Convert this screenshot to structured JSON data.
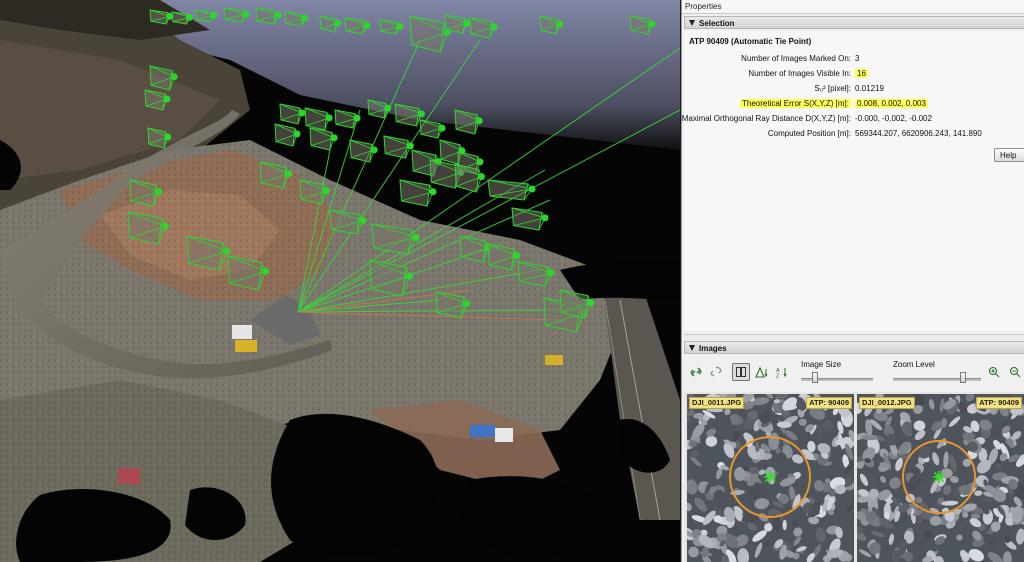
{
  "properties": {
    "panel_title": "Properties",
    "selection_header": "Selection",
    "atp_title": "ATP 90409 (Automatic Tie Point)",
    "rows": [
      {
        "label": "Number of Images Marked On:",
        "value": "3",
        "highlight": false
      },
      {
        "label": "Number of Images Visible In:",
        "value": "16",
        "highlight": true
      },
      {
        "label": "S₀² [pixel]:",
        "value": "0.01219",
        "highlight": false
      },
      {
        "label": "Theoretical Error S(X,Y,Z) [m]:",
        "value": "0.008, 0.002, 0.003",
        "highlight": true
      },
      {
        "label": "Maximal Orthogonal Ray Distance D(X,Y,Z) [m]:",
        "value": "-0.000, -0.002, -0.002",
        "highlight": false
      },
      {
        "label": "Computed Position [m]:",
        "value": "569344.207, 6620906.243, 141.890",
        "highlight": false
      }
    ],
    "help_button": "Help"
  },
  "images_panel": {
    "header": "Images",
    "toolbar": {
      "icons": [
        "link-icon",
        "unlink-icon",
        "vertical-layout-icon",
        "sort-triangle-icon",
        "sort-az-icon"
      ],
      "image_size_label": "Image Size",
      "image_size_value": 0.17,
      "zoom_level_label": "Zoom Level",
      "zoom_level_value": 0.82,
      "zoom_in_icon": "zoom-in-icon",
      "zoom_out_icon": "zoom-out-icon"
    },
    "thumbnails": [
      {
        "filename": "DJI_0011.JPG",
        "atp": "ATP: 90409"
      },
      {
        "filename": "DJI_0012.JPG",
        "atp": "ATP: 90409"
      }
    ],
    "marker_color": "#e8952a",
    "tie_point_color": "#3ddc2a"
  },
  "viewport": {
    "camera_color": "#2ed52e",
    "sky_color": "#7f85a6"
  }
}
